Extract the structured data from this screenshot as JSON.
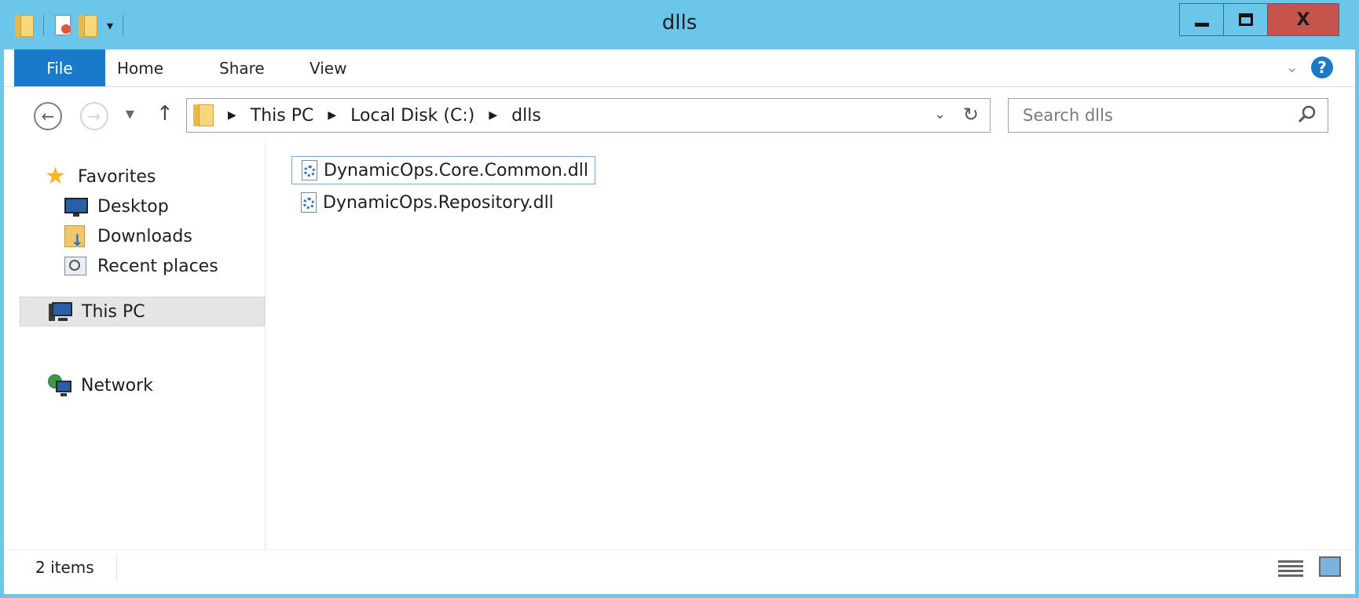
{
  "window": {
    "title": "dlls",
    "min_icon": "minimize-icon",
    "max_icon": "maximize-icon",
    "close_label": "X"
  },
  "ribbon": {
    "file_tab": "File",
    "tabs": [
      "Home",
      "Share",
      "View"
    ],
    "help_label": "?"
  },
  "address": {
    "crumbs": [
      "This PC",
      "Local Disk (C:)",
      "dlls"
    ]
  },
  "search": {
    "placeholder": "Search dlls"
  },
  "navpane": {
    "favorites": "Favorites",
    "desktop": "Desktop",
    "downloads": "Downloads",
    "recent": "Recent places",
    "thispc": "This PC",
    "network": "Network"
  },
  "files": [
    {
      "name": "DynamicOps.Core.Common.dll",
      "focused": true
    },
    {
      "name": "DynamicOps.Repository.dll",
      "focused": false
    }
  ],
  "status": {
    "item_count": "2 items"
  },
  "colors": {
    "titlebar": "#6bc6e9",
    "file_tab": "#1979ca",
    "close_button": "#c6534c"
  }
}
